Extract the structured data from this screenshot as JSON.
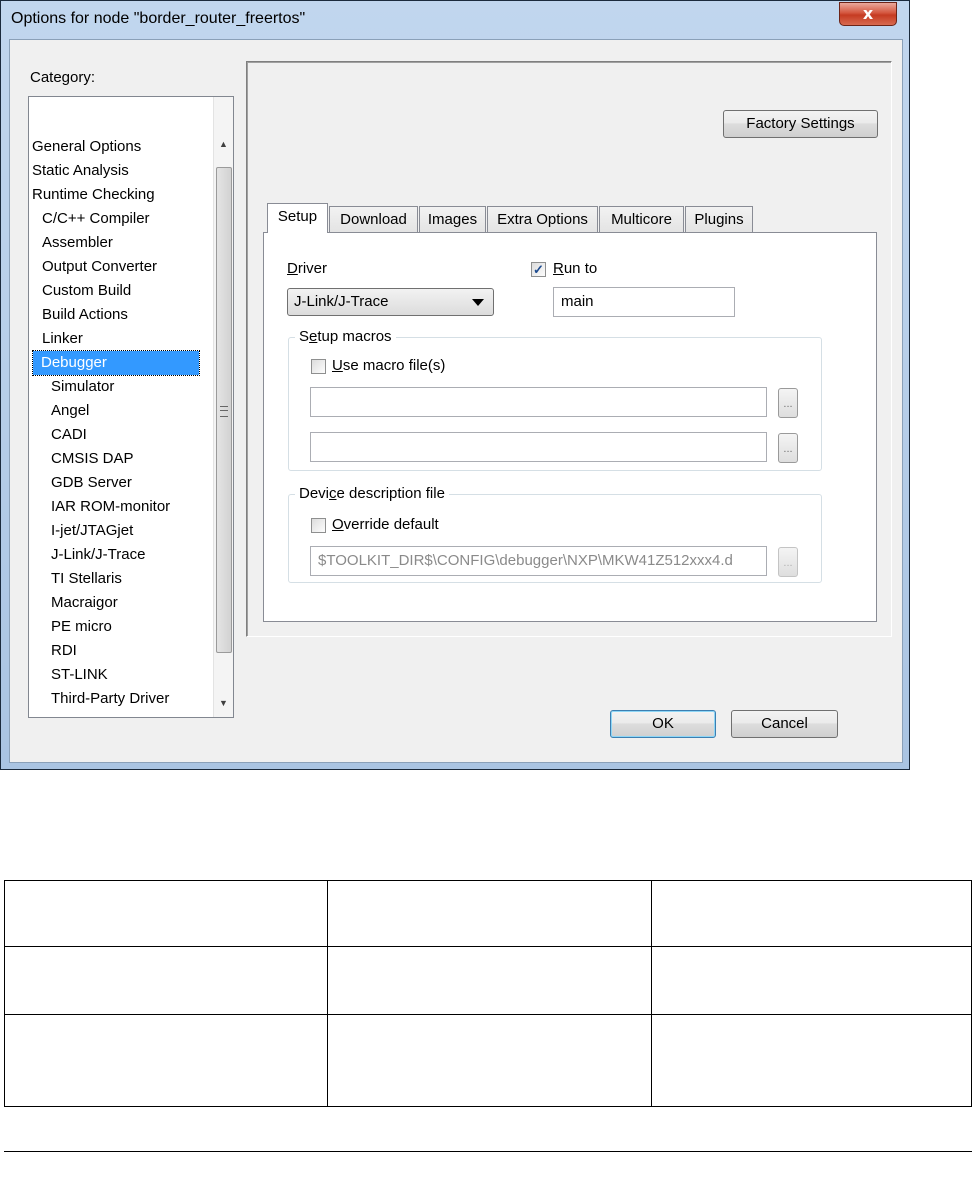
{
  "window": {
    "title": "Options for node \"border_router_freertos\"",
    "close_label": "x"
  },
  "category": {
    "label": "Category:",
    "items": [
      {
        "label": "General Options",
        "level": 0
      },
      {
        "label": "Static Analysis",
        "level": 0
      },
      {
        "label": "Runtime Checking",
        "level": 0
      },
      {
        "label": "C/C++ Compiler",
        "level": 1
      },
      {
        "label": "Assembler",
        "level": 1
      },
      {
        "label": "Output Converter",
        "level": 1
      },
      {
        "label": "Custom Build",
        "level": 1
      },
      {
        "label": "Build Actions",
        "level": 1
      },
      {
        "label": "Linker",
        "level": 1
      },
      {
        "label": "Debugger",
        "level": 1,
        "selected": true
      },
      {
        "label": "Simulator",
        "level": 2
      },
      {
        "label": "Angel",
        "level": 2
      },
      {
        "label": "CADI",
        "level": 2
      },
      {
        "label": "CMSIS DAP",
        "level": 2
      },
      {
        "label": "GDB Server",
        "level": 2
      },
      {
        "label": "IAR ROM-monitor",
        "level": 2
      },
      {
        "label": "I-jet/JTAGjet",
        "level": 2
      },
      {
        "label": "J-Link/J-Trace",
        "level": 2
      },
      {
        "label": "TI Stellaris",
        "level": 2
      },
      {
        "label": "Macraigor",
        "level": 2
      },
      {
        "label": "PE micro",
        "level": 2
      },
      {
        "label": "RDI",
        "level": 2
      },
      {
        "label": "ST-LINK",
        "level": 2
      },
      {
        "label": "Third-Party Driver",
        "level": 2
      }
    ]
  },
  "factory_settings_label": "Factory Settings",
  "tabs": [
    "Setup",
    "Download",
    "Images",
    "Extra Options",
    "Multicore",
    "Plugins"
  ],
  "setup": {
    "driver_label_prefix": "D",
    "driver_label_rest": "river",
    "driver_value": "J-Link/J-Trace",
    "run_to_prefix": "R",
    "run_to_rest": "un to",
    "run_to_checked": true,
    "run_to_value": "main",
    "setup_macros_label_a": "S",
    "setup_macros_label_u": "e",
    "setup_macros_label_b": "tup macros",
    "use_macro_prefix": "U",
    "use_macro_rest": "se macro file(s)",
    "use_macro_checked": false,
    "macro_file_1": "",
    "macro_file_2": "",
    "browse_label": "...",
    "device_label_a": "Devi",
    "device_label_u": "c",
    "device_label_b": "e description file",
    "override_prefix": "O",
    "override_rest": "verride default",
    "override_checked": false,
    "device_file": "$TOOLKIT_DIR$\\CONFIG\\debugger\\NXP\\MKW41Z512xxx4.d"
  },
  "buttons": {
    "ok": "OK",
    "cancel": "Cancel"
  },
  "colors": {
    "selection": "#3399ff",
    "dialog_bg": "#f0f0f0"
  }
}
